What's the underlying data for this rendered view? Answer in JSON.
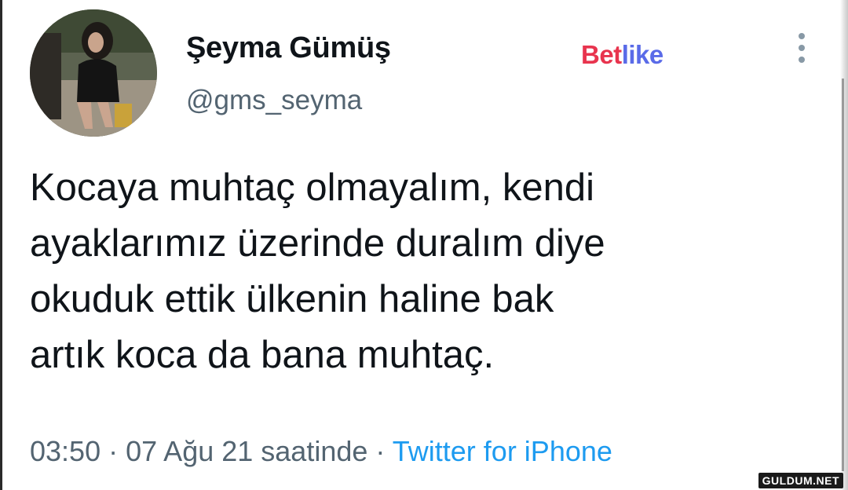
{
  "user": {
    "display_name": "Şeyma Gümüş",
    "handle": "@gms_seyma"
  },
  "watermark": {
    "part_a": "Bet",
    "part_b": "like"
  },
  "tweet": {
    "lines": [
      "Kocaya muhtaç olmayalım, kendi",
      "ayaklarımız üzerinde duralım diye",
      "okuduk ettik ülkenin haline bak",
      "artık koca da bana muhtaç."
    ]
  },
  "meta": {
    "time": "03:50",
    "date": "07 Ağu 21 saatinde",
    "separator": "·",
    "source": "Twitter for iPhone"
  },
  "footer": {
    "logo_text": "GULDUM.NET"
  },
  "icons": {
    "more": "more-vertical-icon",
    "avatar": "profile-photo"
  },
  "colors": {
    "handle": "#536471",
    "link": "#1d9bf0",
    "text": "#0f1419"
  }
}
